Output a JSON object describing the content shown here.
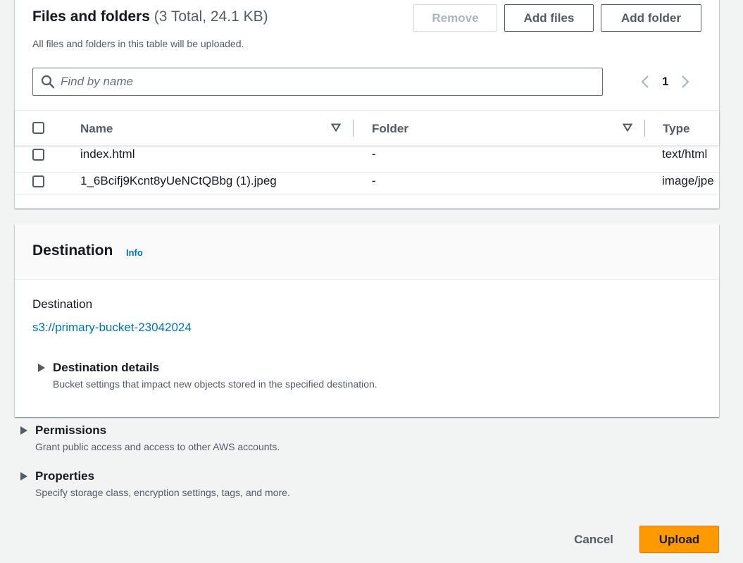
{
  "files_panel": {
    "title": "Files and folders",
    "count": "(3 Total, 24.1 KB)",
    "description": "All files and folders in this table will be uploaded.",
    "remove_label": "Remove",
    "add_files_label": "Add files",
    "add_folder_label": "Add folder",
    "search_placeholder": "Find by name",
    "page_number": "1",
    "columns": [
      "Name",
      "Folder",
      "Type"
    ],
    "rows": [
      {
        "name": "index.html",
        "folder": "-",
        "type": "text/html"
      },
      {
        "name": "1_6Bcifj9Kcnt8yUeNCtQBbg (1).jpeg",
        "folder": "-",
        "type": "image/jpe"
      }
    ]
  },
  "destination": {
    "title": "Destination",
    "info_label": "Info",
    "label": "Destination",
    "uri": "s3://primary-bucket-23042024",
    "details_title": "Destination details",
    "details_desc": "Bucket settings that impact new objects stored in the specified destination."
  },
  "permissions": {
    "title": "Permissions",
    "desc": "Grant public access and access to other AWS accounts."
  },
  "properties": {
    "title": "Properties",
    "desc": "Specify storage class, encryption settings, tags, and more."
  },
  "footer": {
    "cancel_label": "Cancel",
    "upload_label": "Upload"
  },
  "colors": {
    "accent": "#ff9900",
    "link": "#0073bb"
  }
}
